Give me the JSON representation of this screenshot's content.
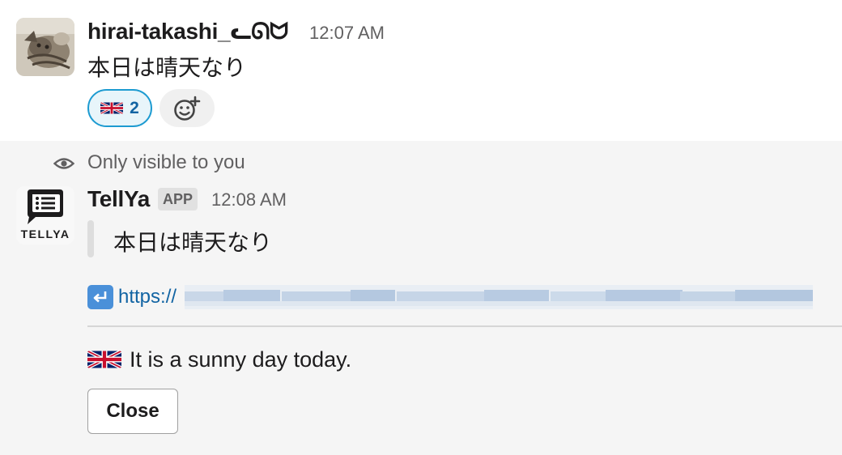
{
  "message1": {
    "username": "hirai-takashi_ᓚᘏᗢ",
    "time": "12:07 AM",
    "text": "本日は晴天なり",
    "reaction": {
      "emoji": "uk-flag-icon",
      "count": "2"
    },
    "add_reaction": "add-reaction-icon"
  },
  "message2": {
    "visibility_note": "Only visible to you",
    "avatar_label": "TELLYA",
    "app_name": "TellYa",
    "badge": "APP",
    "time": "12:08 AM",
    "quote": "本日は晴天なり",
    "link_icon": "return-arrow-icon",
    "link_text": "https://",
    "translation_flag": "uk-flag-icon",
    "translation": "It is a sunny day today.",
    "close_label": "Close"
  },
  "colors": {
    "link": "#1264a3",
    "reaction_border": "#1d9bd1",
    "reaction_bg": "#e8f5fa",
    "ephemeral_bg": "#f5f5f5",
    "muted_text": "#616061"
  }
}
